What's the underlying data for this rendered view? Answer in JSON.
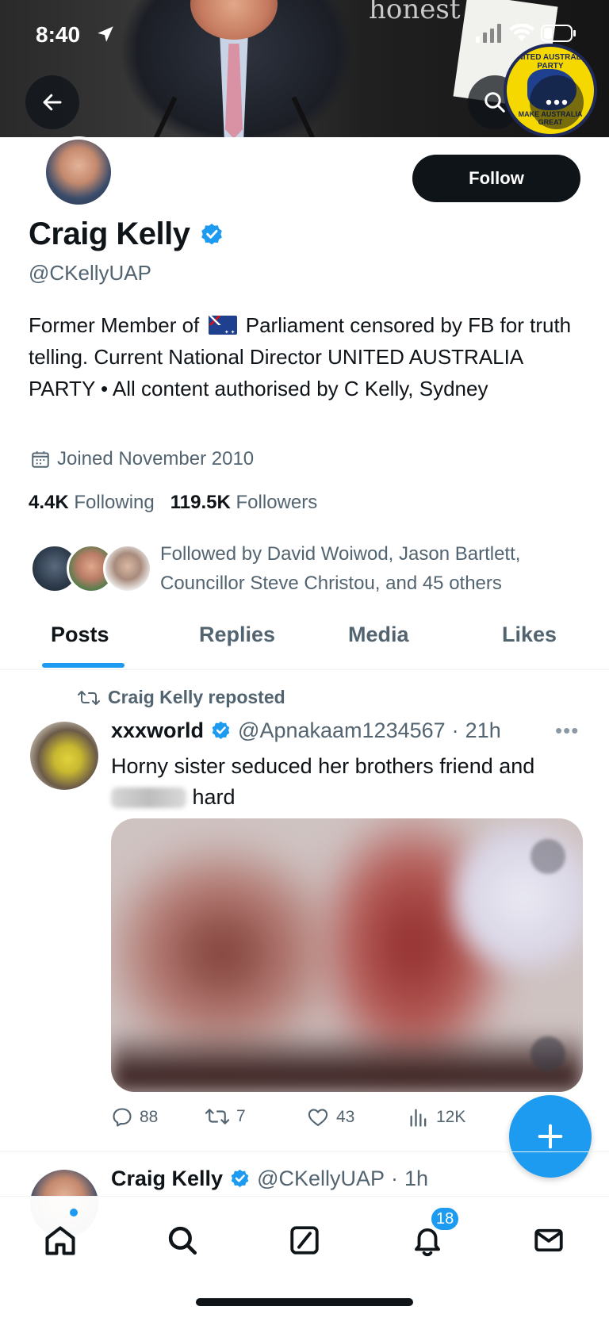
{
  "status_bar": {
    "time": "8:40"
  },
  "banner": {
    "word": "honest"
  },
  "profile": {
    "display_name": "Craig Kelly",
    "handle": "@CKellyUAP",
    "follow_label": "Follow",
    "bio_part1": "Former Member of",
    "bio_part2": "Parliament censored by FB for truth telling. Current National Director UNITED AUSTRALIA PARTY • All content authorised by C Kelly, Sydney",
    "joined": "Joined November 2010",
    "following_count": "4.4K",
    "following_label": "Following",
    "followers_count": "119.5K",
    "followers_label": "Followers",
    "followed_by": "Followed by David Woiwod, Jason Bartlett, Councillor Steve Christou, and 45 others"
  },
  "tabs": [
    {
      "label": "Posts",
      "active": true
    },
    {
      "label": "Replies",
      "active": false
    },
    {
      "label": "Media",
      "active": false
    },
    {
      "label": "Likes",
      "active": false
    }
  ],
  "post": {
    "repost_label": "Craig Kelly reposted",
    "author_name": "xxxworld",
    "author_handle": "@Apnakaam1234567",
    "time": "21h",
    "text_part1": "Horny sister seduced her brothers friend and",
    "text_part2": "hard",
    "replies": "88",
    "reposts": "7",
    "likes": "43",
    "views": "12K"
  },
  "post2": {
    "author_name": "Craig Kelly",
    "author_handle": "@CKellyUAP",
    "time": "1h"
  },
  "nav": {
    "notification_count": "18"
  },
  "colors": {
    "accent": "#1d9bf0",
    "text": "#0f1419",
    "muted": "#536471"
  }
}
